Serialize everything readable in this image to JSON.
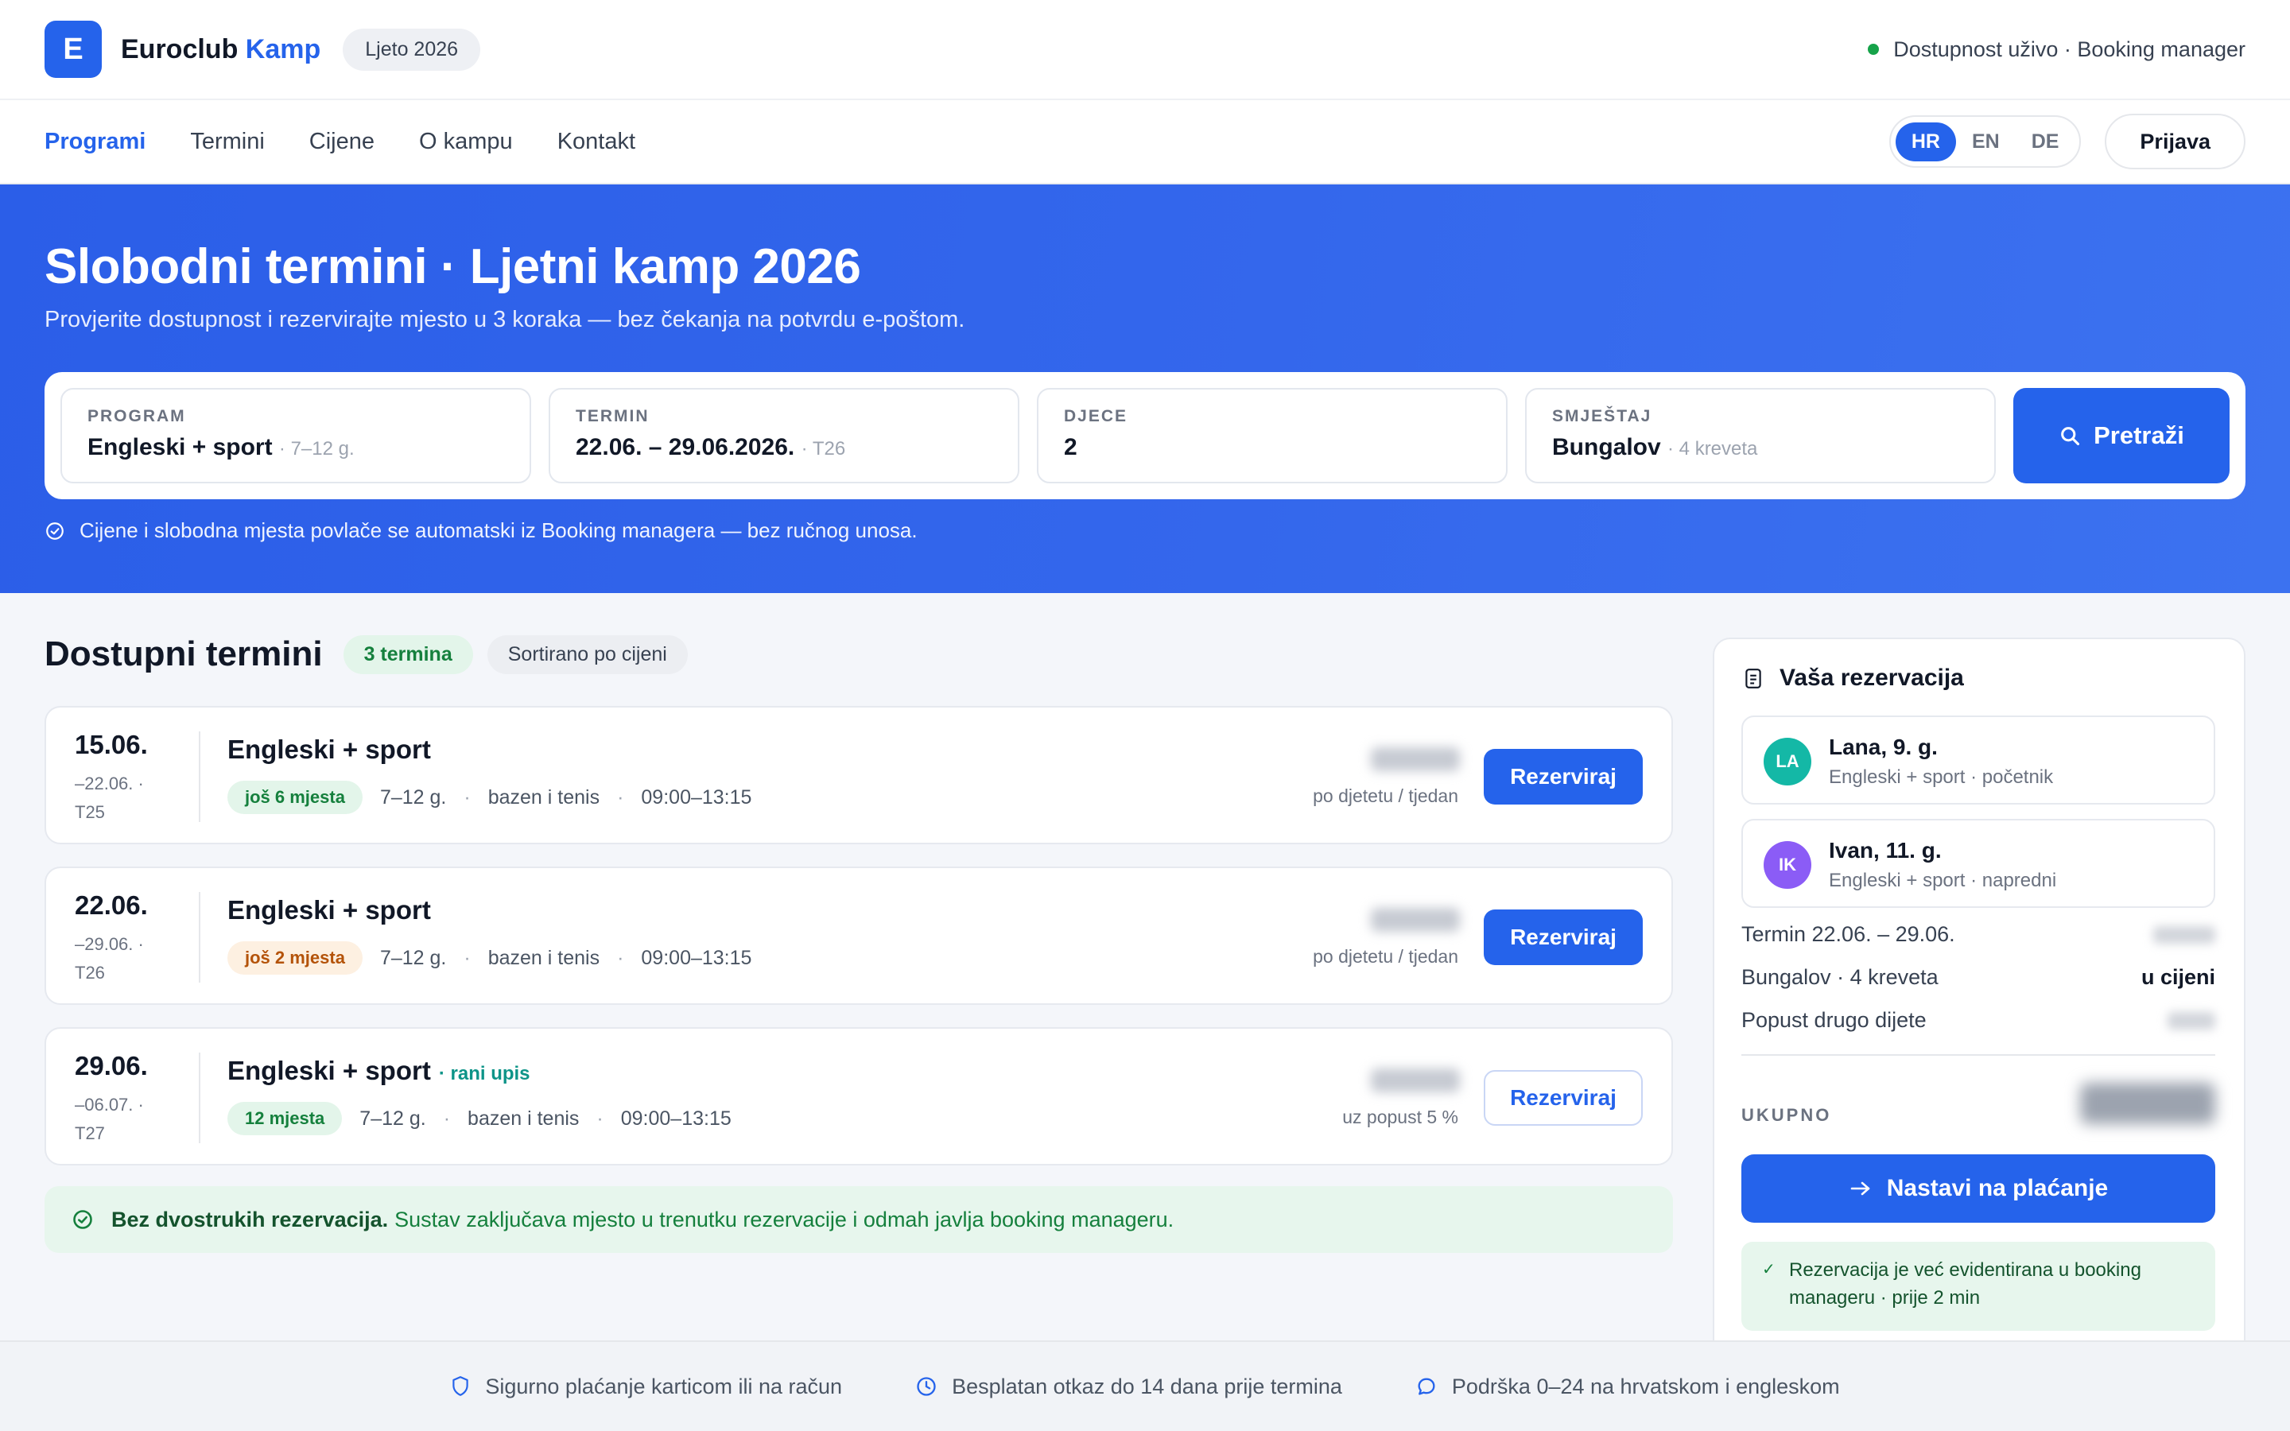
{
  "header": {
    "logo_letter": "E",
    "brand_primary": "Euroclub",
    "brand_accent": "Kamp",
    "season": "Ljeto 2026",
    "live_status": "Dostupnost uživo · Booking manager",
    "brand_color": "#2563eb",
    "live_color": "#16a34a"
  },
  "nav": {
    "items": [
      {
        "label": "Programi",
        "active": true
      },
      {
        "label": "Termini"
      },
      {
        "label": "Cijene"
      },
      {
        "label": "O kampu"
      },
      {
        "label": "Kontakt"
      }
    ],
    "languages": [
      {
        "label": "HR",
        "active": true
      },
      {
        "label": "EN"
      },
      {
        "label": "DE"
      }
    ],
    "login_label": "Prijava"
  },
  "hero": {
    "title": "Slobodni termini · Ljetni kamp 2026",
    "subtitle": "Provjerite dostupnost i rezervirajte mjesto u 3 koraka — bez čekanja na potvrdu e-poštom.",
    "note": "Cijene i slobodna mjesta povlače se automatski iz Booking managera — bez ručnog unosa.",
    "search": {
      "program": {
        "label": "PROGRAM",
        "value": "Engleski + sport",
        "hint": "· 7–12 g."
      },
      "term": {
        "label": "TERMIN",
        "value": "22.06. – 29.06.2026.",
        "hint": "· T26"
      },
      "children": {
        "label": "DJECE",
        "value": "2"
      },
      "accommodation": {
        "label": "SMJEŠTAJ",
        "value": "Bungalov",
        "hint": "· 4 kreveta"
      },
      "button_label": "Pretraži"
    }
  },
  "results": {
    "title": "Dostupni termini",
    "count_badge": "3 termina",
    "sort_badge": "Sortirano po cijeni",
    "slots": [
      {
        "date_start": "15.06.",
        "date_end": "–22.06. ·",
        "code": "T25",
        "program": "Engleski + sport",
        "early_note": "",
        "availability": "još 6 mjesta",
        "availability_level": "ok",
        "age": "7–12 g.",
        "activity": "bazen i tenis",
        "hours": "09:00–13:15",
        "price_note": "po djetetu / tjedan",
        "button_label": "Rezerviraj"
      },
      {
        "date_start": "22.06.",
        "date_end": "–29.06. ·",
        "code": "T26",
        "program": "Engleski + sport",
        "early_note": "",
        "availability": "još 2 mjesta",
        "availability_level": "warn",
        "age": "7–12 g.",
        "activity": "bazen i tenis",
        "hours": "09:00–13:15",
        "price_note": "po djetetu / tjedan",
        "button_label": "Rezerviraj"
      },
      {
        "date_start": "29.06.",
        "date_end": "–06.07. ·",
        "code": "T27",
        "program": "Engleski + sport",
        "early_note": "· rani upis",
        "availability": "12 mjesta",
        "availability_level": "ok",
        "age": "7–12 g.",
        "activity": "bazen i tenis",
        "hours": "09:00–13:15",
        "price_note": "uz popust 5 %",
        "button_label": "Rezerviraj"
      }
    ],
    "info_strong": "Bez dvostrukih rezervacija.",
    "info_text": "Sustav zaključava mjesto u trenutku rezervacije i odmah javlja booking manageru."
  },
  "reservation": {
    "title": "Vaša rezervacija",
    "children": [
      {
        "initials": "LA",
        "name": "Lana, 9. g.",
        "detail": "Engleski + sport · početnik",
        "color": "#14b8a6"
      },
      {
        "initials": "IK",
        "name": "Ivan, 11. g.",
        "detail": "Engleski + sport · napredni",
        "color": "#8b5cf6"
      }
    ],
    "lines": [
      {
        "label": "Termin 22.06. – 29.06.",
        "value": ""
      },
      {
        "label": "Bungalov · 4 kreveta",
        "value": "u cijeni"
      },
      {
        "label": "Popust drugo dijete",
        "value": ""
      }
    ],
    "total_label": "UKUPNO",
    "pay_label": "Nastavi na plaćanje",
    "confirmation": "Rezervacija je već evidentirana u booking manageru · prije 2 min"
  },
  "footer": {
    "items": [
      {
        "icon": "shield-icon",
        "text": "Sigurno plaćanje karticom ili na račun"
      },
      {
        "icon": "clock-icon",
        "text": "Besplatan otkaz do 14 dana prije termina"
      },
      {
        "icon": "chat-icon",
        "text": "Podrška 0–24 na hrvatskom i engleskom"
      }
    ]
  }
}
